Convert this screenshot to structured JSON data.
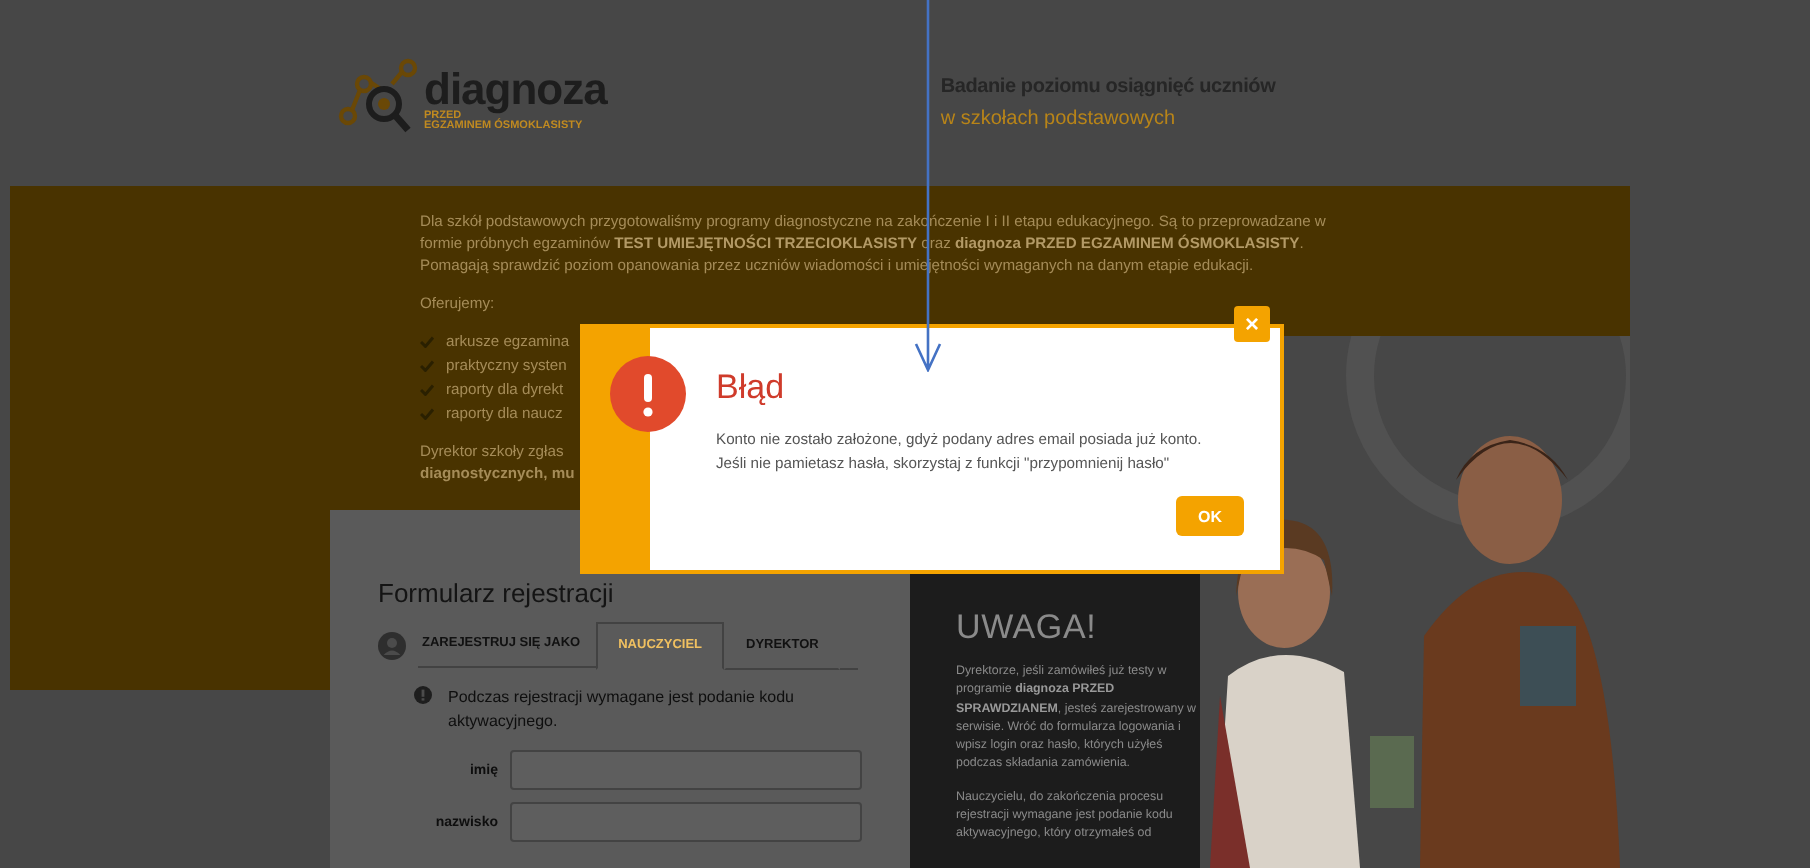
{
  "header": {
    "logo": {
      "name": "diagnoza",
      "tagline": [
        "PRZED",
        "EGZAMINEM ÓSMOKLASISTY"
      ]
    },
    "heading": "Badanie poziomu osiągnięć uczniów",
    "subheading": "w szkołach podstawowych"
  },
  "intro": {
    "paragraph": "Dla szkół podstawowych przygotowaliśmy programy diagnostyczne na zakończenie I i II etapu edukacyjnego. Są to przeprowadzane w formie próbnych egzaminów **TEST UMIEJĘTNOŚCI TRZECIOKLASISTY** oraz **diagnoza PRZED EGZAMINEM ÓSMOKLASISTY**. Pomagają sprawdzić poziom opanowania przez uczniów wiadomości i umiejętności wymaganych na danym etapie edukacji.",
    "offer_heading": "Oferujemy:",
    "offers": [
      "arkusze egzamina",
      "praktyczny systen",
      "raporty dla dyrekt",
      "raporty dla naucz"
    ],
    "footer_lines": [
      {
        "text": "Dyrektor szkoły zgłas",
        "bold": false
      },
      {
        "text": "diagnostycznych, mu",
        "bold": true
      }
    ]
  },
  "form": {
    "title": "Formularz rejestracji",
    "role_label": "ZAREJESTRUJ SIĘ JAKO",
    "tabs": [
      {
        "label": "NAUCZYCIEL",
        "selected": true
      },
      {
        "label": "DYREKTOR",
        "selected": false
      }
    ],
    "info": "Podczas rejestracji wymagane jest podanie kodu aktywacyjnego.",
    "fields": [
      {
        "label": "imię"
      },
      {
        "label": "nazwisko"
      }
    ]
  },
  "notice": {
    "title": "UWAGA!",
    "paragraphs": [
      "Dyrektorze, jeśli zamówiłeś już testy w programie **diagnoza PRZED SPRAWDZIANEM**, jesteś zarejestrowany w serwisie. Wróć do formularza logowania i wpisz login oraz hasło, których użyłeś podczas składania zamówienia.",
      "Nauczycielu, do zakończenia procesu rejestracji wymagane jest podanie kodu aktywacyjnego, który otrzymałeś od"
    ]
  },
  "dialog": {
    "title": "Błąd",
    "message": [
      "Konto nie zostało założone, gdyż podany adres email posiada już konto.",
      "Jeśli nie pamietasz hasła, skorzystaj z funkcji \"przypomnienij hasło\""
    ],
    "ok_button": "OK",
    "close_button": "×"
  }
}
